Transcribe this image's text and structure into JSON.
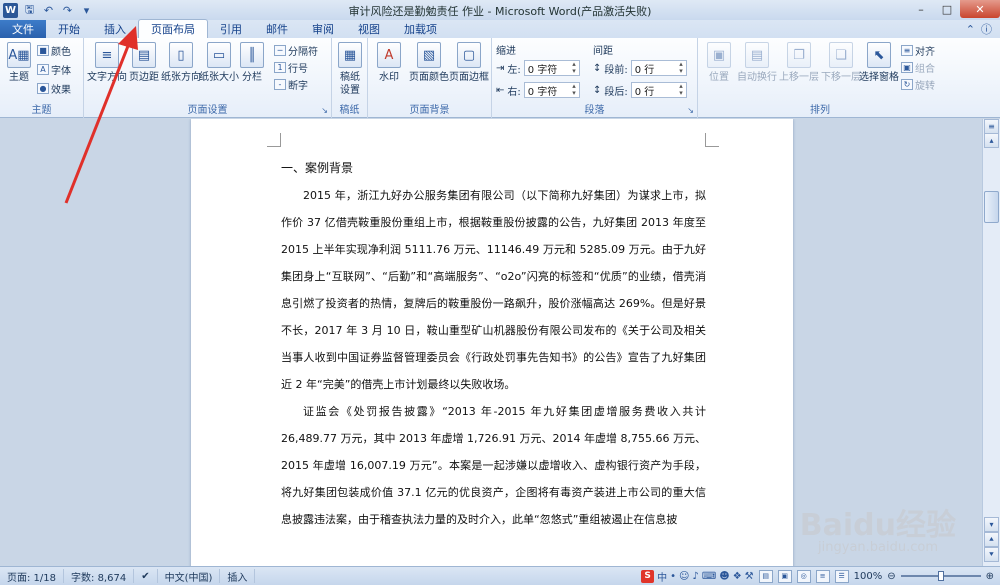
{
  "window": {
    "title": "审计风险还是勤勉责任 作业 - Microsoft Word(产品激活失败)",
    "app_logo": "W"
  },
  "quick_access": {
    "icons": [
      "word-logo",
      "save-icon",
      "undo-icon",
      "redo-icon",
      "customize-icon"
    ]
  },
  "tabs": [
    {
      "label": "文件",
      "kind": "file"
    },
    {
      "label": "开始"
    },
    {
      "label": "插入"
    },
    {
      "label": "页面布局",
      "active": true
    },
    {
      "label": "引用"
    },
    {
      "label": "邮件"
    },
    {
      "label": "审阅"
    },
    {
      "label": "视图"
    },
    {
      "label": "加载项"
    }
  ],
  "ribbon": {
    "theme_group": {
      "label": "主题",
      "big_button": "主题",
      "small_buttons": [
        "颜色",
        "字体",
        "效果"
      ]
    },
    "page_setup_group": {
      "label": "页面设置",
      "big_buttons": [
        "文字方向",
        "页边距",
        "纸张方向",
        "纸张大小",
        "分栏"
      ],
      "small_buttons": [
        "分隔符",
        "行号",
        "断字"
      ]
    },
    "paper_group": {
      "label": "稿纸",
      "big_button": "稿纸设置"
    },
    "background_group": {
      "label": "页面背景",
      "big_buttons": [
        "水印",
        "页面颜色",
        "页面边框"
      ]
    },
    "paragraph_group": {
      "label": "段落",
      "indent_label": "缩进",
      "spacing_label": "间距",
      "indent_left_label": "左:",
      "indent_left_value": "0 字符",
      "indent_right_label": "右:",
      "indent_right_value": "0 字符",
      "space_before_label": "段前:",
      "space_before_value": "0 行",
      "space_after_label": "段后:",
      "space_after_value": "0 行"
    },
    "arrange_group": {
      "label": "排列",
      "big_buttons": [
        "位置",
        "自动换行",
        "上移一层",
        "下移一层",
        "选择窗格"
      ],
      "small_buttons": [
        "对齐",
        "组合",
        "旋转"
      ]
    }
  },
  "document": {
    "heading": "一、案例背景",
    "paragraphs": [
      "2015 年，浙江九好办公服务集团有限公司（以下简称九好集团）为谋求上市，拟作价 37 亿借壳鞍重股份重组上市，根据鞍重股份披露的公告，九好集团 2013 年度至 2015 上半年实现净利润 5111.76 万元、11146.49 万元和 5285.09 万元。由于九好集团身上“互联网”、“后勤”和“高端服务”、“o2o”闪亮的标签和“优质”的业绩，借壳消息引燃了投资者的热情，复牌后的鞍重股份一路飙升，股价涨幅高达 269%。但是好景不长，2017 年 3 月 10 日，鞍山重型矿山机器股份有限公司发布的《关于公司及相关当事人收到中国证券监督管理委员会《行政处罚事先告知书》的公告》宣告了九好集团近 2 年“完美”的借壳上市计划最终以失败收场。",
      "证监会《处罚报告披露》“2013 年-2015 年九好集团虚增服务费收入共计 26,489.77 万元，其中 2013 年虚增 1,726.91 万元、2014 年虚增 8,755.66 万元、2015 年虚增 16,007.19 万元”。本案是一起涉嫌以虚增收入、虚构银行资产为手段，将九好集团包装成价值 37.1 亿元的优良资产，企图将有毒资产装进上市公司的重大信息披露违法案，由于稽查执法力量的及时介入，此单“忽悠式”重组被遏止在信息披"
    ]
  },
  "statusbar": {
    "page": "页面: 1/18",
    "words": "字数: 8,674",
    "language": "中文(中国)",
    "mode": "插入",
    "ime_label": "中",
    "zoom": "100%"
  },
  "watermark": {
    "brand": "Baidu经验",
    "site": "jingyan.baidu.com"
  },
  "colors": {
    "accent": "#2b579a",
    "annotation_arrow": "#e0302a"
  }
}
